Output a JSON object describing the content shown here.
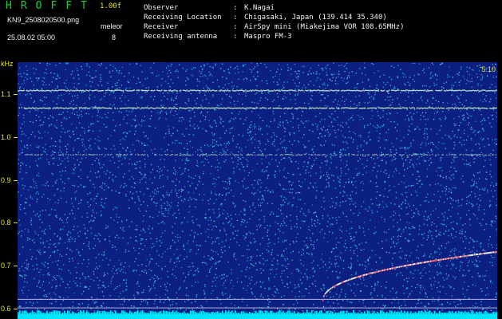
{
  "header": {
    "app_title": "HROFFT",
    "version": "1.00f",
    "file_name": "KN9_2508020500.png",
    "mode_label": "meleor",
    "mode_value": "8",
    "datetime": "25.08.02 05:00"
  },
  "station_info": [
    {
      "key": "Observer",
      "value": "K.Nagai"
    },
    {
      "key": "Receiving Location",
      "value": "Chigasaki, Japan (139.414 35.340)"
    },
    {
      "key": "Receiver",
      "value": "AirSpy mini (Miakejima VOR 108.65MHz)"
    },
    {
      "key": "Receiving antenna",
      "value": "Maspro FM-3"
    }
  ],
  "spectrogram": {
    "unit_label": "kHz",
    "time_label": "5:10",
    "y_ticks": [
      "1.1",
      "1.0",
      "0.9",
      "0.8",
      "0.7",
      "0.6"
    ],
    "tick_values": [
      1.1,
      1.0,
      0.9,
      0.8,
      0.7,
      0.6
    ],
    "freq_range": [
      0.575,
      1.175
    ],
    "horizontal_lines_khz": [
      1.11,
      1.069,
      0.96
    ],
    "meteor_trace": {
      "start_khz": 0.618,
      "end_khz": 0.732
    },
    "colors": {
      "background": "#0c1f82",
      "noise": "#2fb8e6",
      "line": "#c8f0c0",
      "trace": "#ff7070",
      "baseline": "#00e5ff",
      "ticks": "#e8e820"
    }
  }
}
